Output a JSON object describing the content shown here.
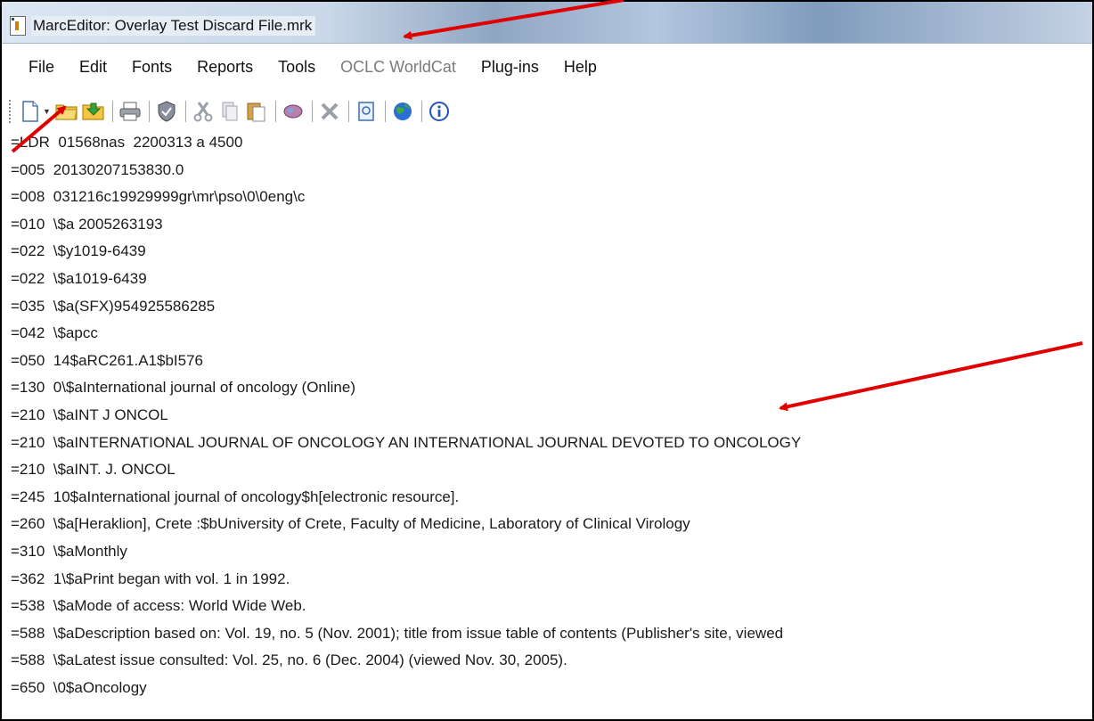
{
  "window": {
    "title": "MarcEditor: Overlay Test Discard File.mrk"
  },
  "menubar": {
    "items": [
      {
        "label": "File",
        "enabled": true
      },
      {
        "label": "Edit",
        "enabled": true
      },
      {
        "label": "Fonts",
        "enabled": true
      },
      {
        "label": "Reports",
        "enabled": true
      },
      {
        "label": "Tools",
        "enabled": true
      },
      {
        "label": "OCLC WorldCat",
        "enabled": false
      },
      {
        "label": "Plug-ins",
        "enabled": true
      },
      {
        "label": "Help",
        "enabled": true
      }
    ]
  },
  "toolbar": {
    "buttons": [
      "new-file-icon",
      "open-folder-icon",
      "save-icon",
      "print-icon",
      "validate-icon",
      "cut-icon",
      "copy-icon",
      "paste-icon",
      "find-icon",
      "delete-icon",
      "preview-icon",
      "globe-icon",
      "info-icon"
    ]
  },
  "editor": {
    "lines": [
      "=LDR  01568nas  2200313 a 4500",
      "=005  20130207153830.0",
      "=008  031216c19929999gr\\mr\\pso\\0\\0eng\\c",
      "=010  \\$a 2005263193",
      "=022  \\$y1019-6439",
      "=022  \\$a1019-6439",
      "=035  \\$a(SFX)954925586285",
      "=042  \\$apcc",
      "=050  14$aRC261.A1$bI576",
      "=130  0\\$aInternational journal of oncology (Online)",
      "=210  \\$aINT J ONCOL",
      "=210  \\$aINTERNATIONAL JOURNAL OF ONCOLOGY AN INTERNATIONAL JOURNAL DEVOTED TO ONCOLOGY",
      "=210  \\$aINT. J. ONCOL",
      "=245  10$aInternational journal of oncology$h[electronic resource].",
      "=260  \\$a[Heraklion], Crete :$bUniversity of Crete, Faculty of Medicine, Laboratory of Clinical Virology",
      "=310  \\$aMonthly",
      "=362  1\\$aPrint began with vol. 1 in 1992.",
      "=538  \\$aMode of access: World Wide Web.",
      "=588  \\$aDescription based on: Vol. 19, no. 5 (Nov. 2001); title from issue table of contents (Publisher's site, viewed",
      "=588  \\$aLatest issue consulted: Vol. 25, no. 6 (Dec. 2004) (viewed Nov. 30, 2005).",
      "=650  \\0$aOncology"
    ]
  },
  "annotations": {
    "arrow_color": "#e00000"
  }
}
